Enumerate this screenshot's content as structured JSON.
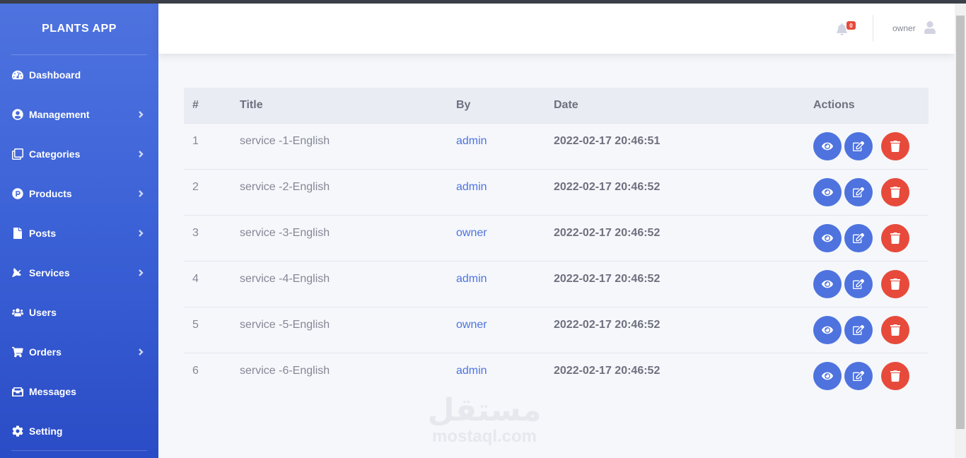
{
  "app": {
    "title": "PLANTS APP"
  },
  "sidebar": {
    "items": [
      {
        "label": "Dashboard",
        "icon": "dashboard-icon",
        "has_submenu": false
      },
      {
        "label": "Management",
        "icon": "user-circle-icon",
        "has_submenu": true
      },
      {
        "label": "Categories",
        "icon": "clone-icon",
        "has_submenu": true
      },
      {
        "label": "Products",
        "icon": "product-hunt-icon",
        "has_submenu": true
      },
      {
        "label": "Posts",
        "icon": "file-icon",
        "has_submenu": true
      },
      {
        "label": "Services",
        "icon": "satellite-dish-icon",
        "has_submenu": true
      },
      {
        "label": "Users",
        "icon": "users-icon",
        "has_submenu": false
      },
      {
        "label": "Orders",
        "icon": "cart-icon",
        "has_submenu": true
      },
      {
        "label": "Messages",
        "icon": "inbox-icon",
        "has_submenu": false
      },
      {
        "label": "Setting",
        "icon": "gear-icon",
        "has_submenu": false
      }
    ]
  },
  "topbar": {
    "notifications_count": "0",
    "user_name": "owner"
  },
  "table": {
    "columns": [
      "#",
      "Title",
      "By",
      "Date",
      "Actions"
    ],
    "rows": [
      {
        "num": "1",
        "title": "service -1-English",
        "by": "admin",
        "date": "2022-02-17 20:46:51"
      },
      {
        "num": "2",
        "title": "service -2-English",
        "by": "admin",
        "date": "2022-02-17 20:46:52"
      },
      {
        "num": "3",
        "title": "service -3-English",
        "by": "owner",
        "date": "2022-02-17 20:46:52"
      },
      {
        "num": "4",
        "title": "service -4-English",
        "by": "admin",
        "date": "2022-02-17 20:46:52"
      },
      {
        "num": "5",
        "title": "service -5-English",
        "by": "owner",
        "date": "2022-02-17 20:46:52"
      },
      {
        "num": "6",
        "title": "service -6-English",
        "by": "admin",
        "date": "2022-02-17 20:46:52"
      }
    ]
  },
  "watermark": {
    "arabic": "مستقل",
    "latin": "mostaql.com"
  },
  "colors": {
    "primary": "#4e73df",
    "danger": "#e74a3b",
    "sidebar_dark": "#2a4cc6"
  }
}
